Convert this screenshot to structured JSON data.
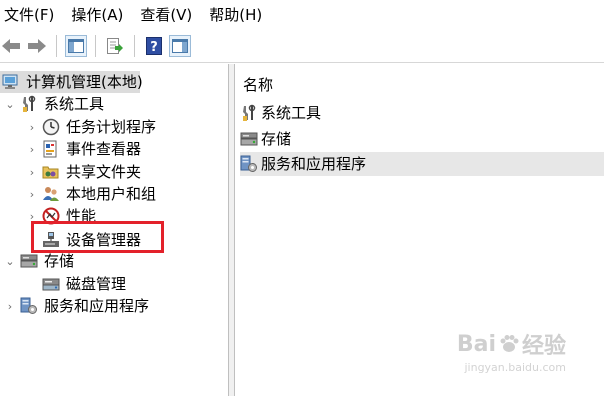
{
  "menubar": {
    "items": [
      "文件(F)",
      "操作(A)",
      "查看(V)",
      "帮助(H)"
    ]
  },
  "toolbar": {
    "buttons": [
      "back-arrow-icon",
      "forward-arrow-icon",
      "show-hide-tree-icon",
      "export-list-icon",
      "help-icon",
      "action-pane-icon"
    ]
  },
  "tree": {
    "root": "计算机管理(本地)",
    "system_tools": "系统工具",
    "task_scheduler": "任务计划程序",
    "event_viewer": "事件查看器",
    "shared_folders": "共享文件夹",
    "local_users": "本地用户和组",
    "performance": "性能",
    "device_manager": "设备管理器",
    "storage": "存储",
    "disk_management": "磁盘管理",
    "services_apps": "服务和应用程序"
  },
  "list": {
    "column_name": "名称",
    "rows": [
      "系统工具",
      "存储",
      "服务和应用程序"
    ]
  },
  "watermark": {
    "logo_left": "Bai",
    "logo_right": "经验",
    "url": "jingyan.baidu.com"
  },
  "colors": {
    "highlight_border": "#e3212a",
    "selected_row": "#e7e7e7",
    "root_row": "#dcdcdc"
  }
}
